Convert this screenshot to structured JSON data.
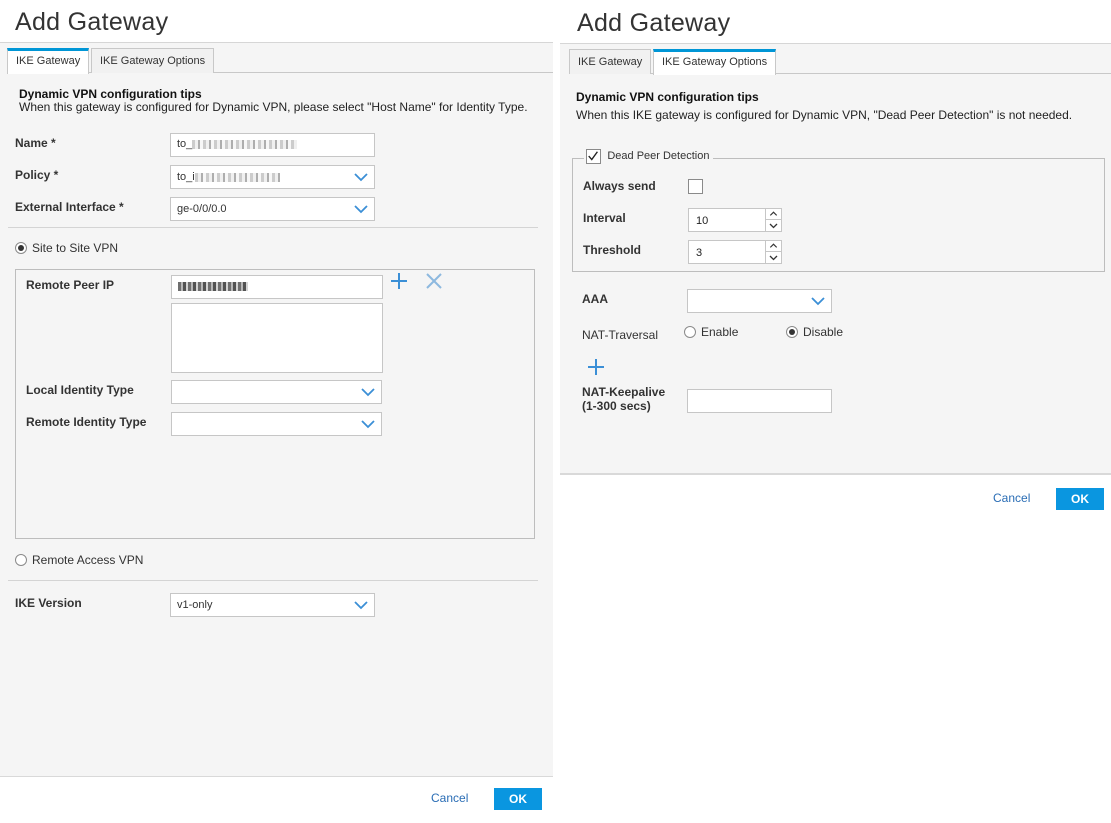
{
  "left": {
    "title": "Add Gateway",
    "tabs": [
      {
        "label": "IKE Gateway",
        "active": true
      },
      {
        "label": "IKE Gateway Options",
        "active": false
      }
    ],
    "tips_title": "Dynamic VPN configuration tips",
    "tips_text": "When this gateway is configured for Dynamic VPN, please select \"Host Name\" for Identity Type.",
    "name_label": "Name *",
    "name_value": "to_",
    "policy_label": "Policy *",
    "policy_value": "to_i",
    "external_interface_label": "External Interface *",
    "external_interface_value": "ge-0/0/0.0",
    "site_to_site_label": "Site to Site VPN",
    "site_to_site_selected": true,
    "remote_peer_ip_label": "Remote Peer IP",
    "local_identity_type_label": "Local Identity Type",
    "local_identity_type_value": "",
    "remote_identity_type_label": "Remote Identity Type",
    "remote_identity_type_value": "",
    "remote_access_label": "Remote Access VPN",
    "remote_access_selected": false,
    "ike_version_label": "IKE Version",
    "ike_version_value": "v1-only",
    "cancel_label": "Cancel",
    "ok_label": "OK"
  },
  "right": {
    "title": "Add Gateway",
    "tabs": [
      {
        "label": "IKE Gateway",
        "active": false
      },
      {
        "label": "IKE Gateway Options",
        "active": true
      }
    ],
    "tips_title": "Dynamic VPN configuration tips",
    "tips_text": "When this IKE gateway is configured for Dynamic VPN, \"Dead Peer Detection\" is not needed.",
    "dpd_label": "Dead Peer Detection",
    "dpd_checked": true,
    "always_send_label": "Always send",
    "always_send_checked": false,
    "interval_label": "Interval",
    "interval_value": "10",
    "threshold_label": "Threshold",
    "threshold_value": "3",
    "aaa_label": "AAA",
    "aaa_value": "",
    "nat_traversal_label": "NAT-Traversal",
    "nat_enable_label": "Enable",
    "nat_disable_label": "Disable",
    "nat_selected": "Disable",
    "nat_keepalive_label": "NAT-Keepalive",
    "nat_keepalive_range": "(1-300 secs)",
    "nat_keepalive_value": "",
    "cancel_label": "Cancel",
    "ok_label": "OK"
  },
  "colors": {
    "accent": "#0a96e0",
    "tab_active_border": "#0096d6",
    "link": "#2a6db5",
    "icon": "#3b8fd6"
  },
  "icons": {
    "chevron": "chevron-down-icon",
    "add": "plus-icon",
    "remove": "close-icon",
    "check": "checkmark-icon"
  }
}
